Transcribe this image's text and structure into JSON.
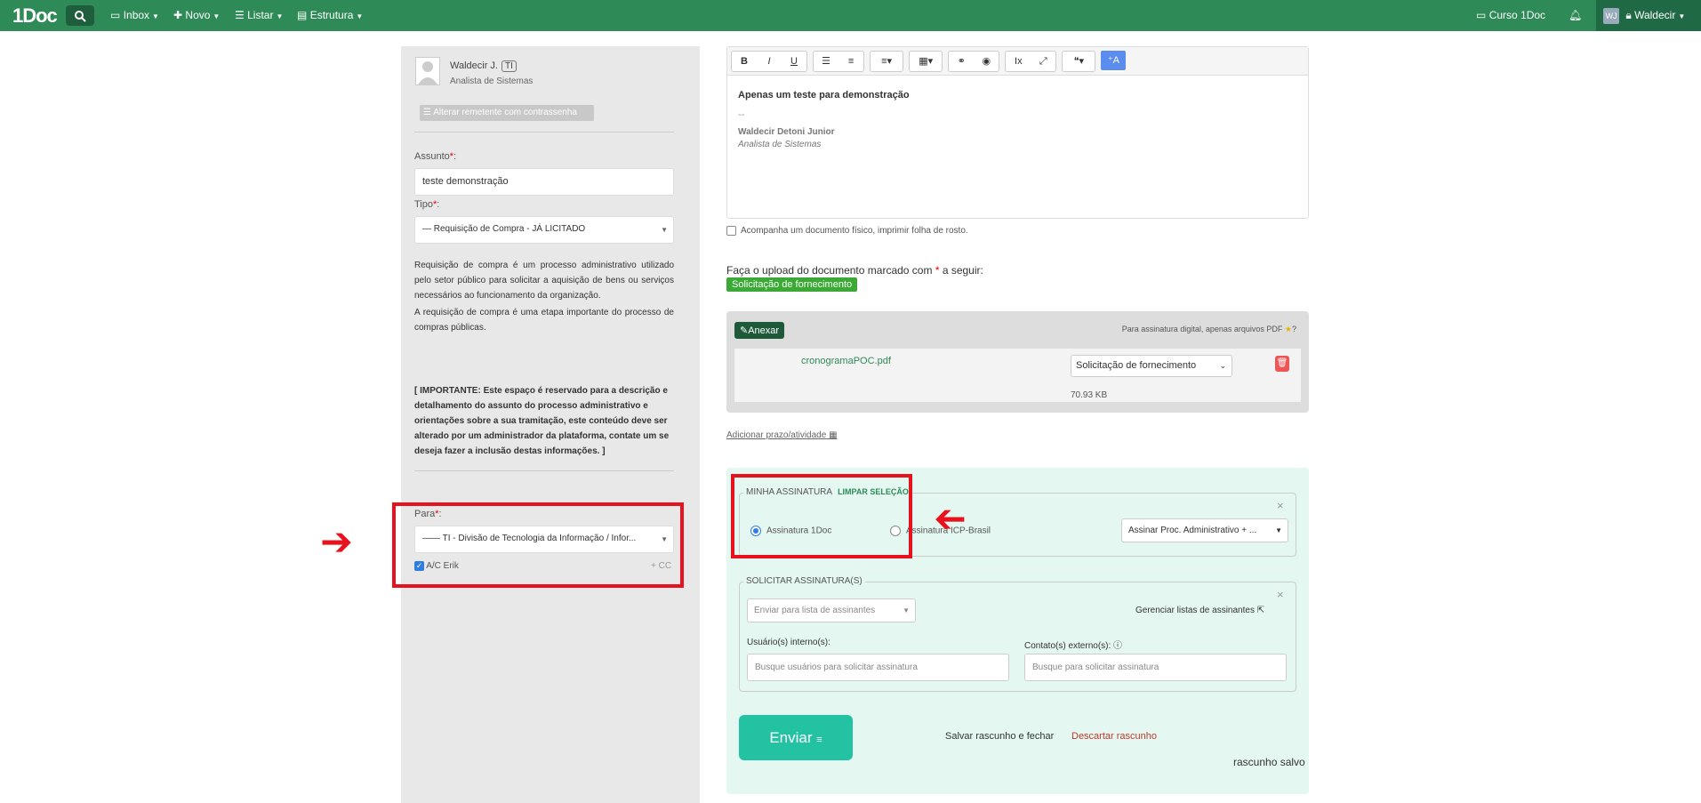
{
  "topbar": {
    "brand": "1Doc",
    "nav": [
      {
        "icon": "inbox-icon",
        "label": "Inbox"
      },
      {
        "icon": "plus-icon",
        "label": "Novo"
      },
      {
        "icon": "list-icon",
        "label": "Listar"
      },
      {
        "icon": "building-icon",
        "label": "Estrutura"
      }
    ],
    "course_label": "Curso 1Doc",
    "user_initials": "WJ",
    "user_name": "Waldecir"
  },
  "sender": {
    "name": "Waldecir J.",
    "badge": "TI",
    "role": "Analista de Sistemas",
    "change_button": "Alterar remetente com contrassenha"
  },
  "form": {
    "subject_label": "Assunto",
    "subject_value": "teste demonstração",
    "type_label": "Tipo",
    "type_value": "— Requisição de Compra - JÁ LICITADO",
    "description_1": "Requisição de compra é um processo administrativo utilizado pelo setor público para solicitar a aquisição de bens ou serviços necessários ao funcionamento da organização.",
    "description_2": "A requisição de compra é uma etapa importante do processo de compras públicas.",
    "important": "[ IMPORTANTE: Este espaço é reservado para a descrição e detalhamento do assunto do processo administrativo e orientações sobre a sua tramitação, este conteúdo deve ser alterado por um administrador da plataforma, contate um se deseja fazer a inclusão destas informações. ]",
    "to_label": "Para",
    "to_value": "—— TI - Divisão de Tecnologia da Informação / Infor...",
    "ac_label": "A/C Erik",
    "cc_link": "+ CC"
  },
  "editor": {
    "line1": "Apenas um teste para demonstração",
    "line2": "--",
    "sig_name": "Waldecir Detoni Junior",
    "sig_role": "Analista de Sistemas"
  },
  "physical_doc_label": "Acompanha um documento físico, imprimir folha de rosto.",
  "upload": {
    "label_prefix": "Faça o upload do documento marcado com",
    "label_suffix": "a seguir:",
    "tag": "Solicitação de fornecimento",
    "anexar": "Anexar",
    "pdf_note": "Para assinatura digital, apenas arquivos PDF",
    "file_name": "cronogramaPOC.pdf",
    "file_type": "Solicitação de fornecimento",
    "file_size": "70.93 KB"
  },
  "deadline_link": "Adicionar prazo/atividade",
  "signature": {
    "legend": "MINHA ASSINATURA",
    "clear": "LIMPAR SELEÇÃO",
    "option1": "Assinatura 1Doc",
    "option2": "Assinatura ICP-Brasil",
    "sign_select": "Assinar Proc. Administrativo + ..."
  },
  "request": {
    "legend": "SOLICITAR ASSINATURA(S)",
    "list_select": "Enviar para lista de assinantes",
    "manage": "Gerenciar listas de assinantes",
    "internal_label": "Usuário(s) interno(s):",
    "internal_placeholder": "Busque usuários para solicitar assinatura",
    "external_label": "Contato(s) externo(s):",
    "external_placeholder": "Busque para solicitar assinatura"
  },
  "actions": {
    "send": "Enviar",
    "save_close": "Salvar rascunho e fechar",
    "discard": "Descartar rascunho",
    "saved": "rascunho salvo"
  }
}
